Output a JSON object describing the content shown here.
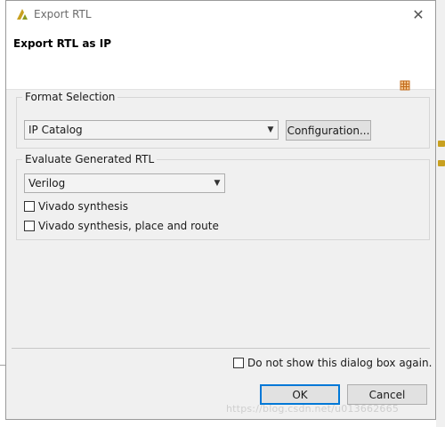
{
  "window": {
    "title": "Export RTL",
    "close_glyph": "✕"
  },
  "header": {
    "title": "Export RTL as IP"
  },
  "format_selection": {
    "label": "Format Selection",
    "format_value": "IP Catalog",
    "configuration_label": "Configuration..."
  },
  "evaluate": {
    "label": "Evaluate Generated RTL",
    "language_value": "Verilog",
    "options": [
      {
        "label": "Vivado synthesis",
        "checked": false
      },
      {
        "label": "Vivado synthesis, place and route",
        "checked": false
      }
    ]
  },
  "footer": {
    "dont_show_label": "Do not show this dialog box again.",
    "ok_label": "OK",
    "cancel_label": "Cancel"
  },
  "watermark": "https://blog.csdn.net/u013662665",
  "icons": {
    "app": "vivado-hls-logo-icon",
    "header": "ip-grid-icon",
    "dropdown": "chevron-down-icon"
  },
  "colors": {
    "accent": "#0078d7",
    "dialog_bg": "#f0f0f0",
    "logo": "#c8a020"
  }
}
